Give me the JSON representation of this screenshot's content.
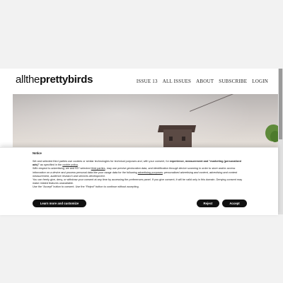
{
  "site": {
    "logo_part1": "allthe",
    "logo_part2": "prettybirds"
  },
  "nav": {
    "items": [
      "ISSUE 13",
      "ALL ISSUES",
      "ABOUT",
      "SUBSCRIBE",
      "LOGIN"
    ]
  },
  "consent": {
    "title": "Notice",
    "p1_a": "We and selected third parties use cookies or similar technologies for technical purposes and, with your consent, for ",
    "p1_b": "experience, measurement and “marketing (personalized ads)”",
    "p1_c": " as specified in the ",
    "p1_link": "cookie policy",
    "p1_d": ".",
    "p2_a": "With respect to advertising, we and 937 selected ",
    "p2_link1": "third parties",
    "p2_b": ", may use ",
    "p2_c": "precise geolocation data, and identification through device scanning",
    "p2_d": " in order to ",
    "p2_e": "store and/or access information on a device",
    "p2_f": " and process personal data like your usage data for the following ",
    "p2_link2": "advertising purposes",
    "p2_g": ": ",
    "p2_h": "personalised advertising and content, advertising and content measurement, audience research and services development",
    "p2_i": ".",
    "p3": "You can freely give, deny, or withdraw your consent at any time by accessing the preferences panel. If you give consent, it will be valid only in this domain. Denying consent may make related features unavailable.",
    "p4": "Use the “Accept” button to consent. Use the “Reject” button to continue without accepting.",
    "learn_more_label": "Learn more and customize",
    "reject_label": "Reject",
    "accept_label": "Accept"
  }
}
